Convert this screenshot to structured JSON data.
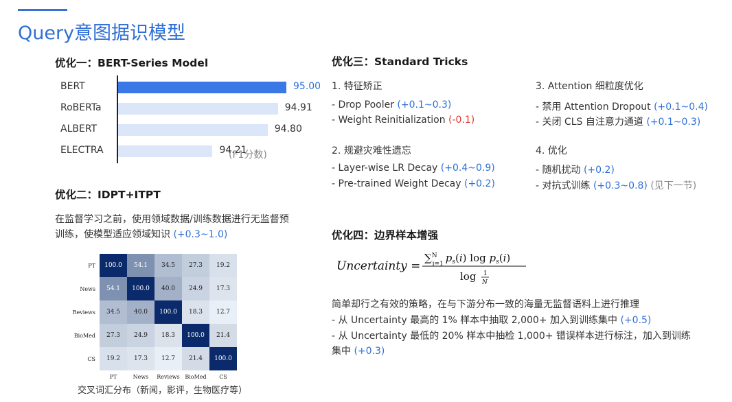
{
  "title": "Query意图据识模型",
  "section1": {
    "heading": "优化一：BERT-Series Model",
    "unit_note": "(F1分数)"
  },
  "chart_data": {
    "type": "bar",
    "orientation": "horizontal",
    "categories": [
      "BERT",
      "RoBERTa",
      "ALBERT",
      "ELECTRA"
    ],
    "values": [
      95.0,
      94.91,
      94.8,
      94.21
    ],
    "value_labels": [
      "95.00",
      "94.91",
      "94.80",
      "94.21"
    ],
    "highlight_index": 0,
    "colors": {
      "highlight": "#3b78e7",
      "normal": "#dbe6f9",
      "highlight_text": "#2f6fd6",
      "normal_text": "#333333"
    }
  },
  "section2": {
    "heading": "优化二：IDPT+ITPT",
    "desc_line1": "在监督学习之前，使用领域数据/训练数据进行无监督预",
    "desc_line2_prefix": "训练，使模型适应领域知识",
    "desc_line2_gain": "(+0.3~1.0)",
    "heatmap_caption": "交叉词汇分布（新闻，影评，生物医疗等）"
  },
  "heatmap": {
    "labels": [
      "PT",
      "News",
      "Reviews",
      "BioMed",
      "CS"
    ],
    "values": [
      [
        "100.0",
        "54.1",
        "34.5",
        "27.3",
        "19.2"
      ],
      [
        "54.1",
        "100.0",
        "40.0",
        "24.9",
        "17.3"
      ],
      [
        "34.5",
        "40.0",
        "100.0",
        "18.3",
        "12.7"
      ],
      [
        "27.3",
        "24.9",
        "18.3",
        "100.0",
        "21.4"
      ],
      [
        "19.2",
        "17.3",
        "12.7",
        "21.4",
        "100.0"
      ]
    ]
  },
  "section3": {
    "heading": "优化三：Standard Tricks",
    "g1_title": "1. 特征矫正",
    "g1_i1": "- Drop Pooler",
    "g1_i1_gain": "(+0.1~0.3)",
    "g1_i2": "- Weight Reinitialization",
    "g1_i2_gain": "(-0.1)",
    "g2_title": "2. 规避灾难性遗忘",
    "g2_i1": "- Layer-wise LR Decay",
    "g2_i1_gain": "(+0.4~0.9)",
    "g2_i2": "- Pre-trained Weight Decay",
    "g2_i2_gain": "(+0.2)",
    "g3_title": "3. Attention 细粒度优化",
    "g3_i1": "- 禁用 Attention Dropout",
    "g3_i1_gain": "(+0.1~0.4)",
    "g3_i2": "- 关闭 CLS 自注意力通道",
    "g3_i2_gain": "(+0.1~0.3)",
    "g4_title": "4. 优化",
    "g4_i1": "- 随机扰动",
    "g4_i1_gain": "(+0.2)",
    "g4_i2": "- 对抗式训练",
    "g4_i2_gain": "(+0.3~0.8)",
    "g4_i2_note": "(见下一节)"
  },
  "section4": {
    "heading": "优化四：边界样本增强",
    "formula_lhs": "Uncertainty =",
    "desc1": "简单却行之有效的策略，在与下游分布一致的海量无监督语料上进行推理",
    "desc2": "- 从 Uncertainty 最高的 1% 样本中抽取 2,000+ 加入到训练集中",
    "desc2_gain": "(+0.5)",
    "desc3": "- 从 Uncertainty 最低的 20% 样本中抽检 1,000+ 错误样本进行标注，加入到训练",
    "desc4": "集中",
    "desc4_gain": "(+0.3)"
  }
}
